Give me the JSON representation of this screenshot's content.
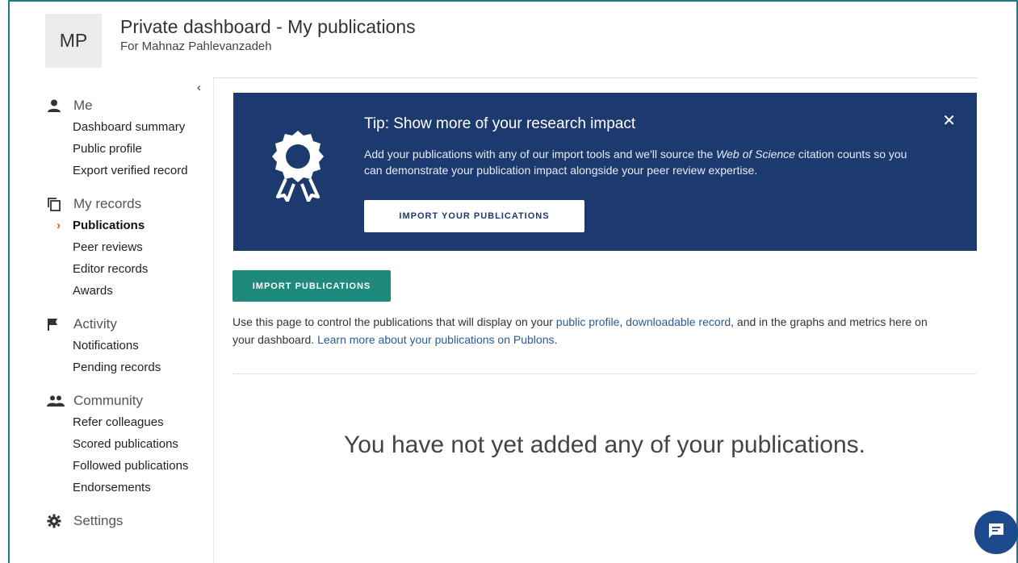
{
  "header": {
    "avatar_initials": "MP",
    "title": "Private dashboard - My publications",
    "subtitle": "For Mahnaz Pahlevanzadeh"
  },
  "sidebar": {
    "collapse_glyph": "‹",
    "sections": [
      {
        "label": "Me",
        "icon": "person-icon",
        "items": [
          "Dashboard summary",
          "Public profile",
          "Export verified record"
        ]
      },
      {
        "label": "My records",
        "icon": "records-icon",
        "items": [
          "Publications",
          "Peer reviews",
          "Editor records",
          "Awards"
        ],
        "active": "Publications"
      },
      {
        "label": "Activity",
        "icon": "flag-icon",
        "items": [
          "Notifications",
          "Pending records"
        ]
      },
      {
        "label": "Community",
        "icon": "people-icon",
        "items": [
          "Refer colleagues",
          "Scored publications",
          "Followed publications",
          "Endorsements"
        ]
      },
      {
        "label": "Settings",
        "icon": "gear-icon",
        "items": []
      }
    ]
  },
  "tip": {
    "title": "Tip: Show more of your research impact",
    "body_pre": "Add your publications with any of our import tools and we'll source the ",
    "body_em": "Web of Science",
    "body_post": " citation counts so you can demonstrate your publication impact alongside your peer review expertise.",
    "button": "IMPORT YOUR PUBLICATIONS",
    "close": "✕"
  },
  "main": {
    "import_button": "IMPORT PUBLICATIONS",
    "desc_1": "Use this page to control the publications that will display on your ",
    "link_profile": "public profile",
    "desc_2": ", ",
    "link_record": "downloadable record",
    "desc_3": ", and in the graphs and metrics here on your dashboard. ",
    "link_learn": "Learn more about your publications on Publons",
    "desc_4": ".",
    "empty_message": "You have not yet added any of your publications."
  }
}
